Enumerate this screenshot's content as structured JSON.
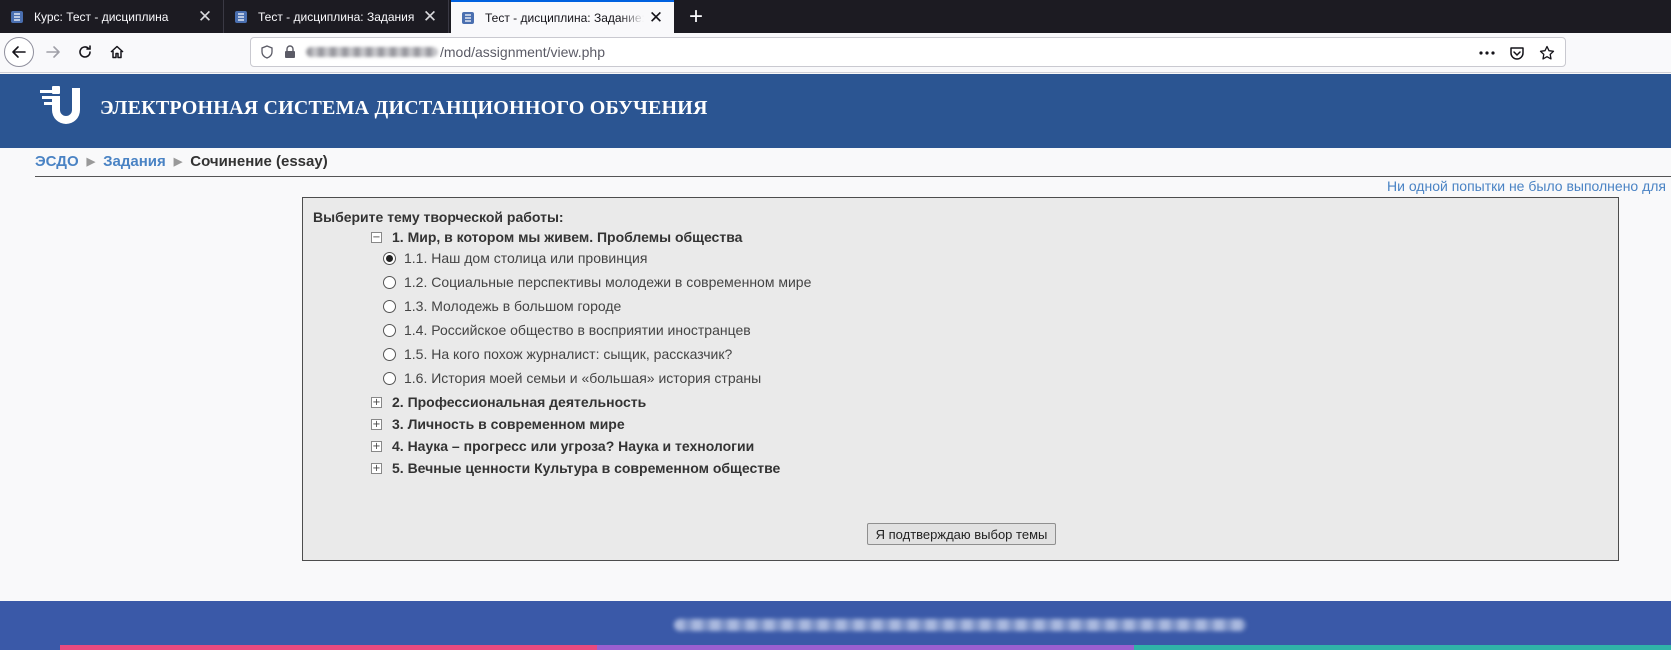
{
  "browser": {
    "tabs": [
      {
        "title": "Курс: Тест - дисциплина",
        "icon": "moodle-favicon-icon",
        "active": false
      },
      {
        "title": "Тест - дисциплина: Задания",
        "icon": "moodle-favicon-icon",
        "active": false
      },
      {
        "title": "Тест - дисциплина: Задание: Сочинение (essay)",
        "icon": "moodle-favicon-icon",
        "active": true
      }
    ],
    "close_glyph": "✕",
    "newtab_glyph": "+",
    "url_path": "/mod/assignment/view.php"
  },
  "site": {
    "title": "ЭЛЕКТРОННАЯ СИСТЕМА ДИСТАНЦИОННОГО ОБУЧЕНИЯ",
    "header_color": "#2b5592"
  },
  "breadcrumb": {
    "items": [
      {
        "label": "ЭСДО",
        "link": true
      },
      {
        "label": "Задания",
        "link": true
      },
      {
        "label": "Сочинение (essay)",
        "link": false
      }
    ],
    "separator": "▶"
  },
  "status_link": "Ни одной попытки не было выполнено для",
  "form": {
    "title": "Выберите тему творческой работы:",
    "topics": [
      {
        "label": "1. Мир, в котором мы живем. Проблемы общества",
        "expanded": true,
        "toggle": "−",
        "options": [
          {
            "label": "1.1. Наш дом столица или провинция",
            "checked": true
          },
          {
            "label": "1.2. Социальные перспективы молодежи в современном мире",
            "checked": false
          },
          {
            "label": "1.3. Молодежь в большом городе",
            "checked": false
          },
          {
            "label": "1.4. Российское общество в восприятии иностранцев",
            "checked": false
          },
          {
            "label": "1.5. На кого похож журналист: сыщик, рассказчик?",
            "checked": false
          },
          {
            "label": "1.6. История моей семьи и «большая» история страны",
            "checked": false
          }
        ]
      },
      {
        "label": "2. Профессиональная деятельность",
        "expanded": false,
        "toggle": "+"
      },
      {
        "label": "3. Личность в современном мире",
        "expanded": false,
        "toggle": "+"
      },
      {
        "label": "4. Наука – прогресс или угроза? Наука и технологии",
        "expanded": false,
        "toggle": "+"
      },
      {
        "label": "5. Вечные ценности Культура в современном обществе",
        "expanded": false,
        "toggle": "+"
      }
    ],
    "confirm_label": "Я подтверждаю выбор темы"
  },
  "footer": {
    "color": "#3a59a8",
    "stripe_colors": [
      "#e84a7f",
      "#9a5fd0",
      "#2fb3a8"
    ]
  }
}
